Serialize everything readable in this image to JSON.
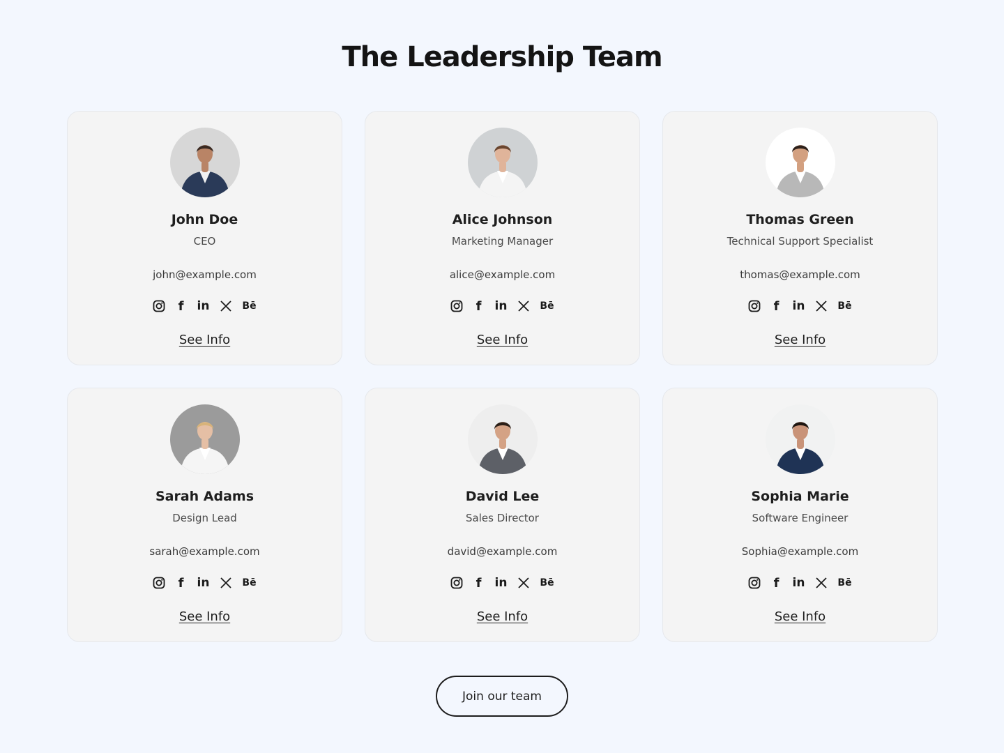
{
  "page": {
    "title": "The Leadership Team"
  },
  "members": [
    {
      "name": "John Doe",
      "role": "CEO",
      "email": "john@example.com",
      "see_info": "See Info",
      "avatar": {
        "bg": "#d7d7d7",
        "shirt": "#2a3a58",
        "inner": "#f2f2f2",
        "skin": "#b98466",
        "hair": "#3a2a22"
      }
    },
    {
      "name": "Alice Johnson",
      "role": "Marketing Manager",
      "email": "alice@example.com",
      "see_info": "See Info",
      "avatar": {
        "bg": "#cfd2d4",
        "shirt": "#f4f4f4",
        "inner": "#ffffff",
        "skin": "#e0b49a",
        "hair": "#6a4630"
      }
    },
    {
      "name": "Thomas Green",
      "role": "Technical Support Specialist",
      "email": "thomas@example.com",
      "see_info": "See Info",
      "avatar": {
        "bg": "#ffffff",
        "shirt": "#b8b8b8",
        "inner": "#ffffff",
        "skin": "#d3a080",
        "hair": "#2e211b"
      }
    },
    {
      "name": "Sarah Adams",
      "role": "Design Lead",
      "email": "sarah@example.com",
      "see_info": "See Info",
      "avatar": {
        "bg": "#9b9b9b",
        "shirt": "#f5f5f5",
        "inner": "#ffffff",
        "skin": "#e5bfa5",
        "hair": "#d8b37a"
      }
    },
    {
      "name": "David Lee",
      "role": "Sales Director",
      "email": "david@example.com",
      "see_info": "See Info",
      "avatar": {
        "bg": "#eeeeee",
        "shirt": "#5d6067",
        "inner": "#ffffff",
        "skin": "#d4a285",
        "hair": "#2b1f18"
      }
    },
    {
      "name": "Sophia Marie",
      "role": "Software Engineer",
      "email": "Sophia@example.com",
      "see_info": "See Info",
      "avatar": {
        "bg": "#f1f2f2",
        "shirt": "#1f3355",
        "inner": "#ffffff",
        "skin": "#c99378",
        "hair": "#1e1510"
      }
    }
  ],
  "socials": [
    {
      "icon": "instagram-icon"
    },
    {
      "icon": "facebook-icon",
      "glyph": "f"
    },
    {
      "icon": "linkedin-icon",
      "glyph": "in"
    },
    {
      "icon": "x-icon"
    },
    {
      "icon": "behance-icon",
      "glyph": "Bē"
    }
  ],
  "cta": {
    "join_label": "Join our team"
  },
  "colors": {
    "background": "#f3f7fe",
    "card": "#f4f4f4",
    "text": "#1c1c1c"
  }
}
